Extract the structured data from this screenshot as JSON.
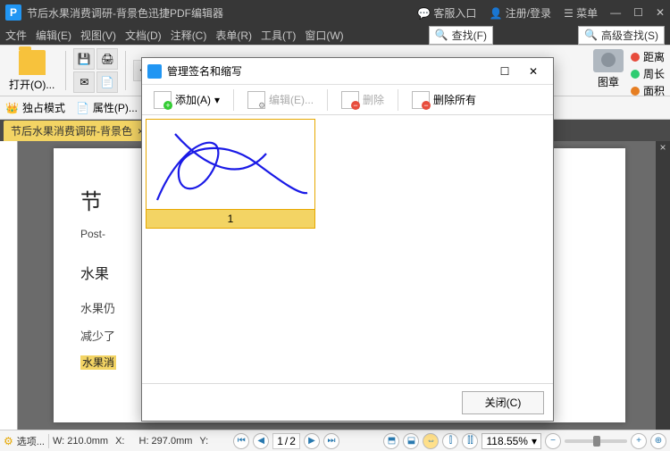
{
  "titlebar": {
    "app": "节后水果消费调研-背景色迅捷PDF编辑器",
    "service": "客服入口",
    "login": "注册/登录",
    "menu": "菜单"
  },
  "menubar": {
    "items": [
      "文件",
      "编辑(E)",
      "视图(V)",
      "文档(D)",
      "注释(C)",
      "表单(R)",
      "工具(T)",
      "窗口(W)"
    ],
    "find": "查找(F)",
    "advfind": "高级查找(S)"
  },
  "toolbar": {
    "open": "打开(O)...",
    "stamp": "图章",
    "measure": {
      "dist": "距离",
      "perim": "周长",
      "area": "面积"
    },
    "zoom": "118.55%"
  },
  "secbar": {
    "exclusive": "独占模式",
    "props": "属性(P)..."
  },
  "tab": {
    "label": "节后水果消费调研-背景色"
  },
  "doc": {
    "h1": "节",
    "sub": "Post-",
    "h2": "水果",
    "p1": "水果仍",
    "p2": "减少了",
    "hl": "水果消"
  },
  "status": {
    "options": "选项...",
    "w": "W: 210.0mm",
    "h": "H: 297.0mm",
    "x": "X:",
    "y": "Y:",
    "page_cur": "1",
    "page_total": "2",
    "zoom": "118.55%"
  },
  "dialog": {
    "title": "管理签名和缩写",
    "add": "添加(A)",
    "edit": "编辑(E)...",
    "delete": "删除",
    "deleteAll": "删除所有",
    "sig_label": "1",
    "close": "关闭(C)"
  }
}
